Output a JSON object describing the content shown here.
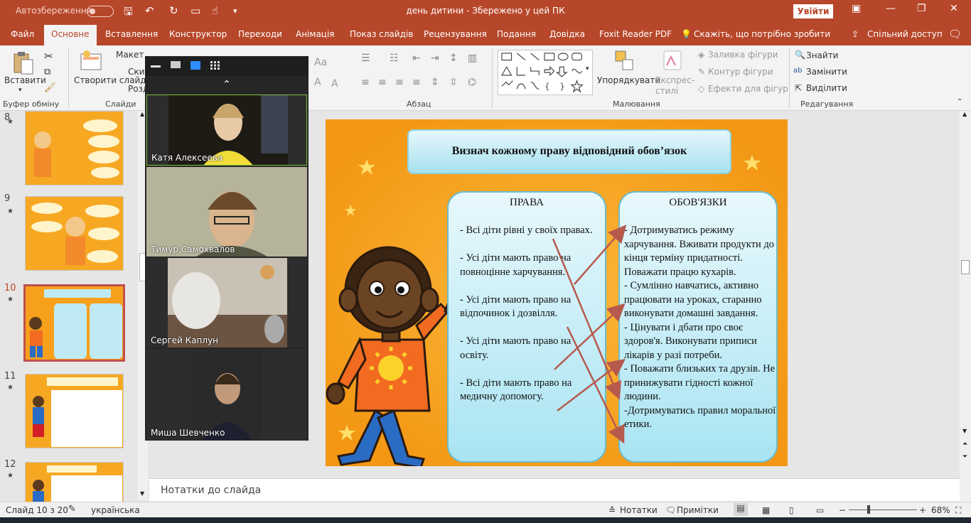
{
  "colors": {
    "accent": "#b7472a",
    "slide_bg": "#f7a01c",
    "box": "#a9e4f2",
    "arrow": "#b65a4e"
  },
  "titlebar": {
    "autosave_label": "Автозбереження",
    "doc_title": "день дитини  -  Збережено у цей ПК",
    "signin_label": "Увійти"
  },
  "tabs": [
    "Файл",
    "Основне",
    "Вставлення",
    "Конструктор",
    "Переходи",
    "Анімація",
    "Показ слайдів",
    "Рецензування",
    "Подання",
    "Довідка",
    "Foxit Reader PDF"
  ],
  "tell_me": "Скажіть, що потрібно зробити",
  "share_label": "Спільний доступ",
  "ribbon": {
    "paste_label": "Вставити",
    "new_slide_label": "Створити слайд",
    "layout_label": "Макет",
    "reset_label": "Ски",
    "section_label": "Розд",
    "arrange_label": "Упорядкувати",
    "quick_styles_label": "Експрес-стилі",
    "shape_fill": "Заливка фігури",
    "shape_outline": "Контур фігури",
    "shape_effects": "Ефекти для фігур",
    "find_label": "Знайти",
    "replace_label": "Замінити",
    "select_label": "Виділити",
    "groups": {
      "clipboard": "Буфер обміну",
      "slides": "Слайди",
      "paragraph": "Абзац",
      "drawing": "Малювання",
      "editing": "Редагування"
    }
  },
  "participants": [
    {
      "name": "Катя Алексеева",
      "active": true
    },
    {
      "name": "Тимур Самохвалов",
      "active": false
    },
    {
      "name": "Сергей Каплун",
      "active": false
    },
    {
      "name": "Миша Шевченко",
      "active": false
    }
  ],
  "thumbnails": [
    {
      "num": "8",
      "star": "★"
    },
    {
      "num": "9",
      "star": "★"
    },
    {
      "num": "10",
      "star": "★",
      "selected": true
    },
    {
      "num": "11",
      "star": "★"
    },
    {
      "num": "12",
      "star": "★"
    }
  ],
  "slide": {
    "title": "Визнач кожному праву відповідний обов’язок",
    "rights_header": "ПРАВА",
    "rights_text": "- Всі діти рівні у своїх правах.\n\n- Усі діти мають право на повноцінне харчування.\n\n- Усі діти мають право на відпочинок і дозвілля.\n\n- Усі діти мають право на освіту.\n\n- Всі діти мають право на медичну допомогу.",
    "duties_header": "ОБОВ'ЯЗКИ",
    "duties_text": "- Дотримуватись режиму харчування. Вживати продукти до кінця терміну придатності. Поважати працю кухарів.\n- Сумлінно навчатись, активно працювати на уроках, старанно виконувати домашні завдання.\n- Цінувати і дбати про своє здоров'я. Виконувати приписи лікарів у разі потреби.\n- Поважати близьких та друзів. Не принижувати гідності кожної людини.\n-Дотримуватись правил моральної етики."
  },
  "notes_placeholder": "Нотатки до слайда",
  "status": {
    "slide_counter": "Слайд 10 з 20",
    "language": "українська",
    "notes_btn": "Нотатки",
    "comments_btn": "Примітки",
    "zoom": "68%"
  }
}
